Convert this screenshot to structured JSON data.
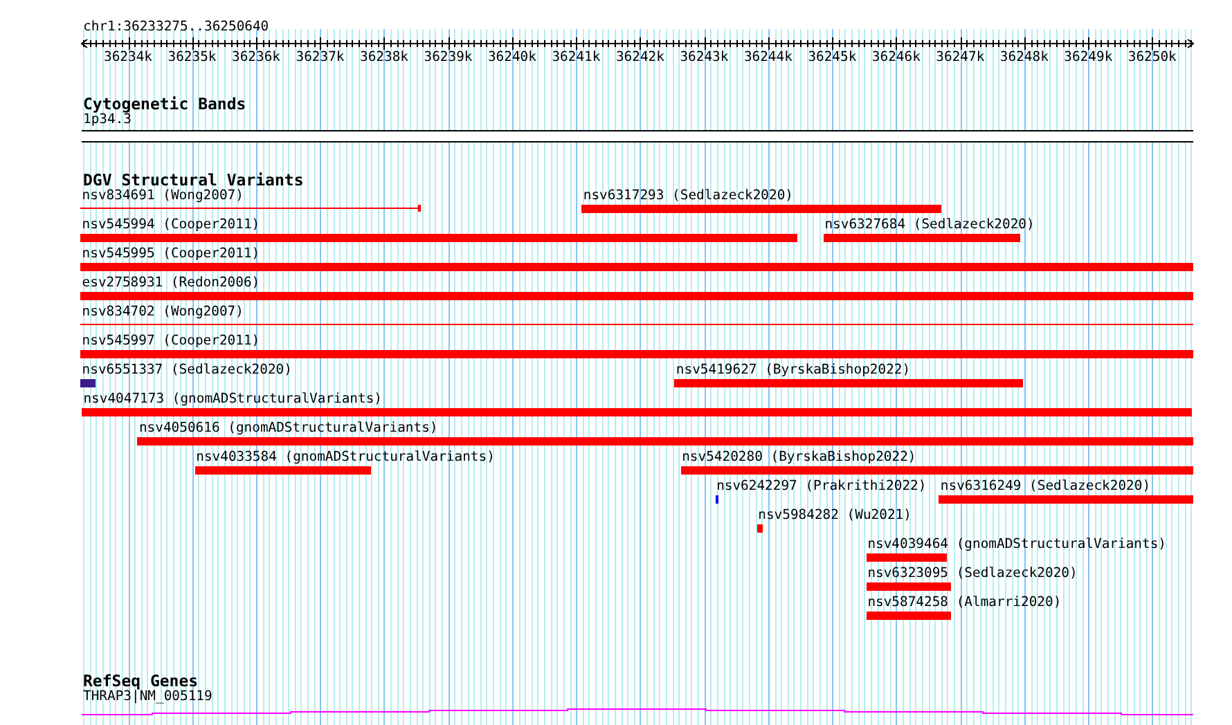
{
  "location": "chr1:36233275..36250640",
  "ruler": {
    "ticks": [
      {
        "label": "36234k"
      },
      {
        "label": "36235k"
      },
      {
        "label": "36236k"
      },
      {
        "label": "36237k"
      },
      {
        "label": "36238k"
      },
      {
        "label": "36239k"
      },
      {
        "label": "36240k"
      },
      {
        "label": "36241k"
      },
      {
        "label": "36242k"
      },
      {
        "label": "36243k"
      },
      {
        "label": "36244k"
      },
      {
        "label": "36245k"
      },
      {
        "label": "36246k"
      },
      {
        "label": "36247k"
      },
      {
        "label": "36248k"
      },
      {
        "label": "36249k"
      },
      {
        "label": "36250k"
      }
    ]
  },
  "tracks": [
    {
      "title": "Cytogenetic Bands",
      "kind": "bands",
      "items": [
        {
          "label": "1p34.3"
        }
      ]
    },
    {
      "title": "DGV Structural Variants",
      "kind": "features",
      "rows": [
        [
          {
            "label": "nsv834691 (Wong2007)",
            "kind": "capped",
            "color": "#ff0000"
          },
          {
            "label": "nsv6317293 (Sedlazeck2020)",
            "kind": "bar",
            "color": "#ff0000"
          }
        ],
        [
          {
            "label": "nsv545994 (Cooper2011)",
            "kind": "bar",
            "color": "#ff0000"
          },
          {
            "label": "nsv6327684 (Sedlazeck2020)",
            "kind": "bar",
            "color": "#ff0000"
          }
        ],
        [
          {
            "label": "nsv545995 (Cooper2011)",
            "kind": "bar",
            "color": "#ff0000"
          }
        ],
        [
          {
            "label": "esv2758931 (Redon2006)",
            "kind": "bar",
            "color": "#ff0000"
          }
        ],
        [
          {
            "label": "nsv834702 (Wong2007)",
            "kind": "line",
            "color": "#ff0000"
          }
        ],
        [
          {
            "label": "nsv545997 (Cooper2011)",
            "kind": "bar",
            "color": "#ff0000"
          }
        ],
        [
          {
            "label": "nsv6551337 (Sedlazeck2020)",
            "kind": "bar",
            "color": "#3c1c8c"
          },
          {
            "label": "nsv5419627 (ByrskaBishop2022)",
            "kind": "bar",
            "color": "#ff0000"
          }
        ],
        [
          {
            "label": "nsv4047173 (gnomADStructuralVariants)",
            "kind": "bar",
            "color": "#ff0000"
          }
        ],
        [
          {
            "label": "nsv4050616 (gnomADStructuralVariants)",
            "kind": "bar",
            "color": "#ff0000"
          }
        ],
        [
          {
            "label": "nsv4033584 (gnomADStructuralVariants)",
            "kind": "bar",
            "color": "#ff0000"
          },
          {
            "label": "nsv5420280 (ByrskaBishop2022)",
            "kind": "bar",
            "color": "#ff0000"
          }
        ],
        [
          {
            "label": "nsv6242297 (Prakrithi2022)",
            "kind": "bar",
            "color": "#0000ff"
          },
          {
            "label": "nsv6316249 (Sedlazeck2020)",
            "kind": "bar",
            "color": "#ff0000"
          }
        ],
        [
          {
            "label": "nsv5984282 (Wu2021)",
            "kind": "bar",
            "color": "#ff0000"
          }
        ],
        [
          {
            "label": "nsv4039464 (gnomADStructuralVariants)",
            "kind": "bar",
            "color": "#ff0000"
          }
        ],
        [
          {
            "label": "nsv6323095 (Sedlazeck2020)",
            "kind": "bar",
            "color": "#ff0000"
          }
        ],
        [
          {
            "label": "nsv5874258 (Almarri2020)",
            "kind": "bar",
            "color": "#ff0000"
          }
        ]
      ]
    },
    {
      "title": "RefSeq Genes",
      "kind": "genes",
      "items": [
        {
          "label": "THRAP3|NM_005119"
        }
      ]
    }
  ]
}
